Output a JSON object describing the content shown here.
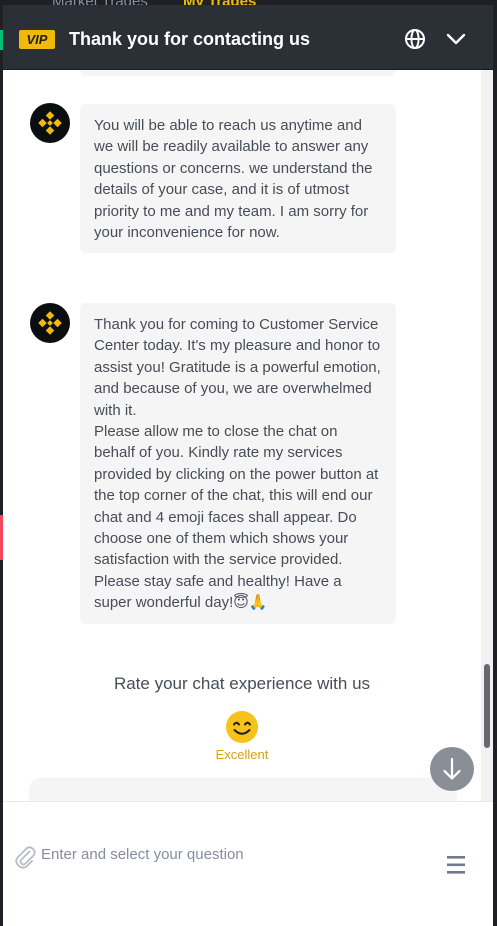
{
  "background": {
    "tabs": [
      "Market Trades",
      "My Trades"
    ],
    "accent_color": "#f0b90b"
  },
  "header": {
    "badge": "VIP",
    "title": "Thank you for contacting us",
    "icons": [
      "globe-icon",
      "chevron-down-icon"
    ]
  },
  "messages": [
    {
      "sender": "agent",
      "avatar_icon": "binance-logo-icon",
      "lines": [
        "You will be able to reach us anytime and we will be readily available to answer any questions or concerns. we understand the details of your case, and it is of utmost priority to me and my team. I am sorry for your inconvenience for now."
      ]
    },
    {
      "sender": "agent",
      "avatar_icon": "binance-logo-icon",
      "lines": [
        "Thank you for coming to Customer Service Center today. It's my pleasure and honor to assist you! Gratitude is a powerful emotion, and because of you, we are overwhelmed with it.",
        "Please allow me to close the chat on behalf of you. Kindly rate my services provided by clicking on the power button at the top corner of the chat, this will end our chat and 4 emoji faces shall appear. Do choose one of them which shows your satisfaction with the service provided.",
        "Please stay safe and healthy! Have a super wonderful day!😇🙏"
      ]
    }
  ],
  "rating": {
    "title": "Rate your chat experience with us",
    "selected_label": "Excellent",
    "selected_icon": "smiling-face-icon"
  },
  "input": {
    "placeholder": "Enter and select your question",
    "value": ""
  },
  "icons": {
    "attach": "paperclip-icon",
    "menu": "menu-icon",
    "scroll": "arrow-down-icon"
  }
}
